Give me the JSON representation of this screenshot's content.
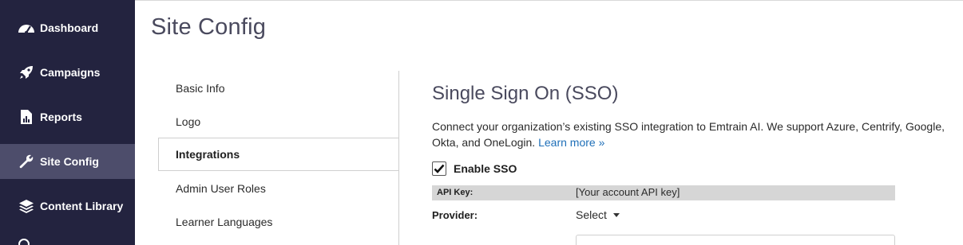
{
  "sidebar": {
    "items": [
      {
        "label": "Dashboard",
        "icon": "gauge-icon"
      },
      {
        "label": "Campaigns",
        "icon": "rocket-icon"
      },
      {
        "label": "Reports",
        "icon": "report-icon"
      },
      {
        "label": "Site Config",
        "icon": "wrench-icon",
        "active": true
      },
      {
        "label": "Content Library",
        "icon": "layers-icon"
      }
    ]
  },
  "header": {
    "title": "Site Config"
  },
  "subnav": {
    "items": [
      "Basic Info",
      "Logo",
      "Integrations",
      "Admin User Roles",
      "Learner Languages"
    ],
    "active": "Integrations"
  },
  "main": {
    "section_title": "Single Sign On (SSO)",
    "description": "Connect your organization’s existing SSO integration to Emtrain AI. We support Azure, Centrify, Google, Okta, and OneLogin.",
    "learn_more": "Learn more »",
    "enable_sso_label": "Enable SSO",
    "enable_sso_checked": true,
    "api_key_label": "API Key:",
    "api_key_value": "[Your account API key]",
    "provider_label": "Provider:",
    "provider_value": "Select"
  },
  "colors": {
    "sidebar_bg": "#23233f",
    "sidebar_active": "#4d4d6b",
    "link": "#1e6fb8"
  }
}
